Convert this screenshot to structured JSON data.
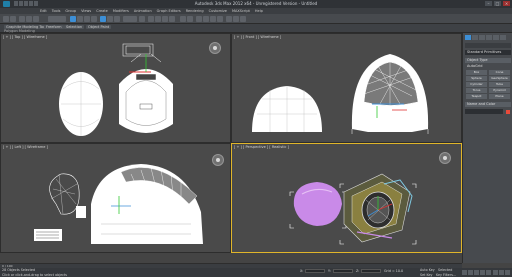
{
  "app": {
    "title": "Autodesk 3ds Max 2012 x64 - Unregistered Version - Untitled"
  },
  "window_controls": {
    "minimize": "–",
    "maximize": "□",
    "close": "×"
  },
  "menu": {
    "items": [
      "Edit",
      "Tools",
      "Group",
      "Views",
      "Create",
      "Modifiers",
      "Animation",
      "Graph Editors",
      "Rendering",
      "Customize",
      "MAXScript",
      "Help"
    ]
  },
  "ribbon": {
    "tabs": [
      "Graphite Modeling Tools",
      "Freeform",
      "Selection",
      "Object Paint"
    ],
    "sub_label": "Polygon Modeling"
  },
  "viewports": {
    "top": {
      "label": "[ + ] [ Top ] [ Wireframe ]",
      "icon": "viewcube-icon"
    },
    "front": {
      "label": "[ + ] [ Front ] [ Wireframe ]"
    },
    "left": {
      "label": "[ + ] [ Left ] [ Wireframe ]"
    },
    "perspective": {
      "label": "[ + ] [ Perspective ] [ Realistic ]",
      "icon": "viewcube-icon"
    }
  },
  "command_panel": {
    "dropdown": "Standard Primitives",
    "rollout_object_type": "Object Type",
    "autogrid": "AutoGrid",
    "buttons": [
      "Box",
      "Cone",
      "Sphere",
      "GeoSphere",
      "Cylinder",
      "Tube",
      "Torus",
      "Pyramid",
      "Teapot",
      "Plane"
    ],
    "rollout_name_color": "Name and Color",
    "color_swatch": "#e84a3a"
  },
  "status": {
    "selection": "28 Objects Selected",
    "prompt": "Click or click-and-drag to select objects",
    "x_label": "X:",
    "y_label": "Y:",
    "z_label": "Z:",
    "grid": "Grid = 10.0",
    "auto_key": "Auto Key",
    "selected": "Selected",
    "set_key": "Set Key",
    "key_filters": "Key Filters..."
  },
  "timeline": {
    "frame": "0 / 100"
  },
  "colors": {
    "active_border": "#e0b52a",
    "helmet_purple": "#c98ae8",
    "accent_blue": "#3d8fd6"
  }
}
